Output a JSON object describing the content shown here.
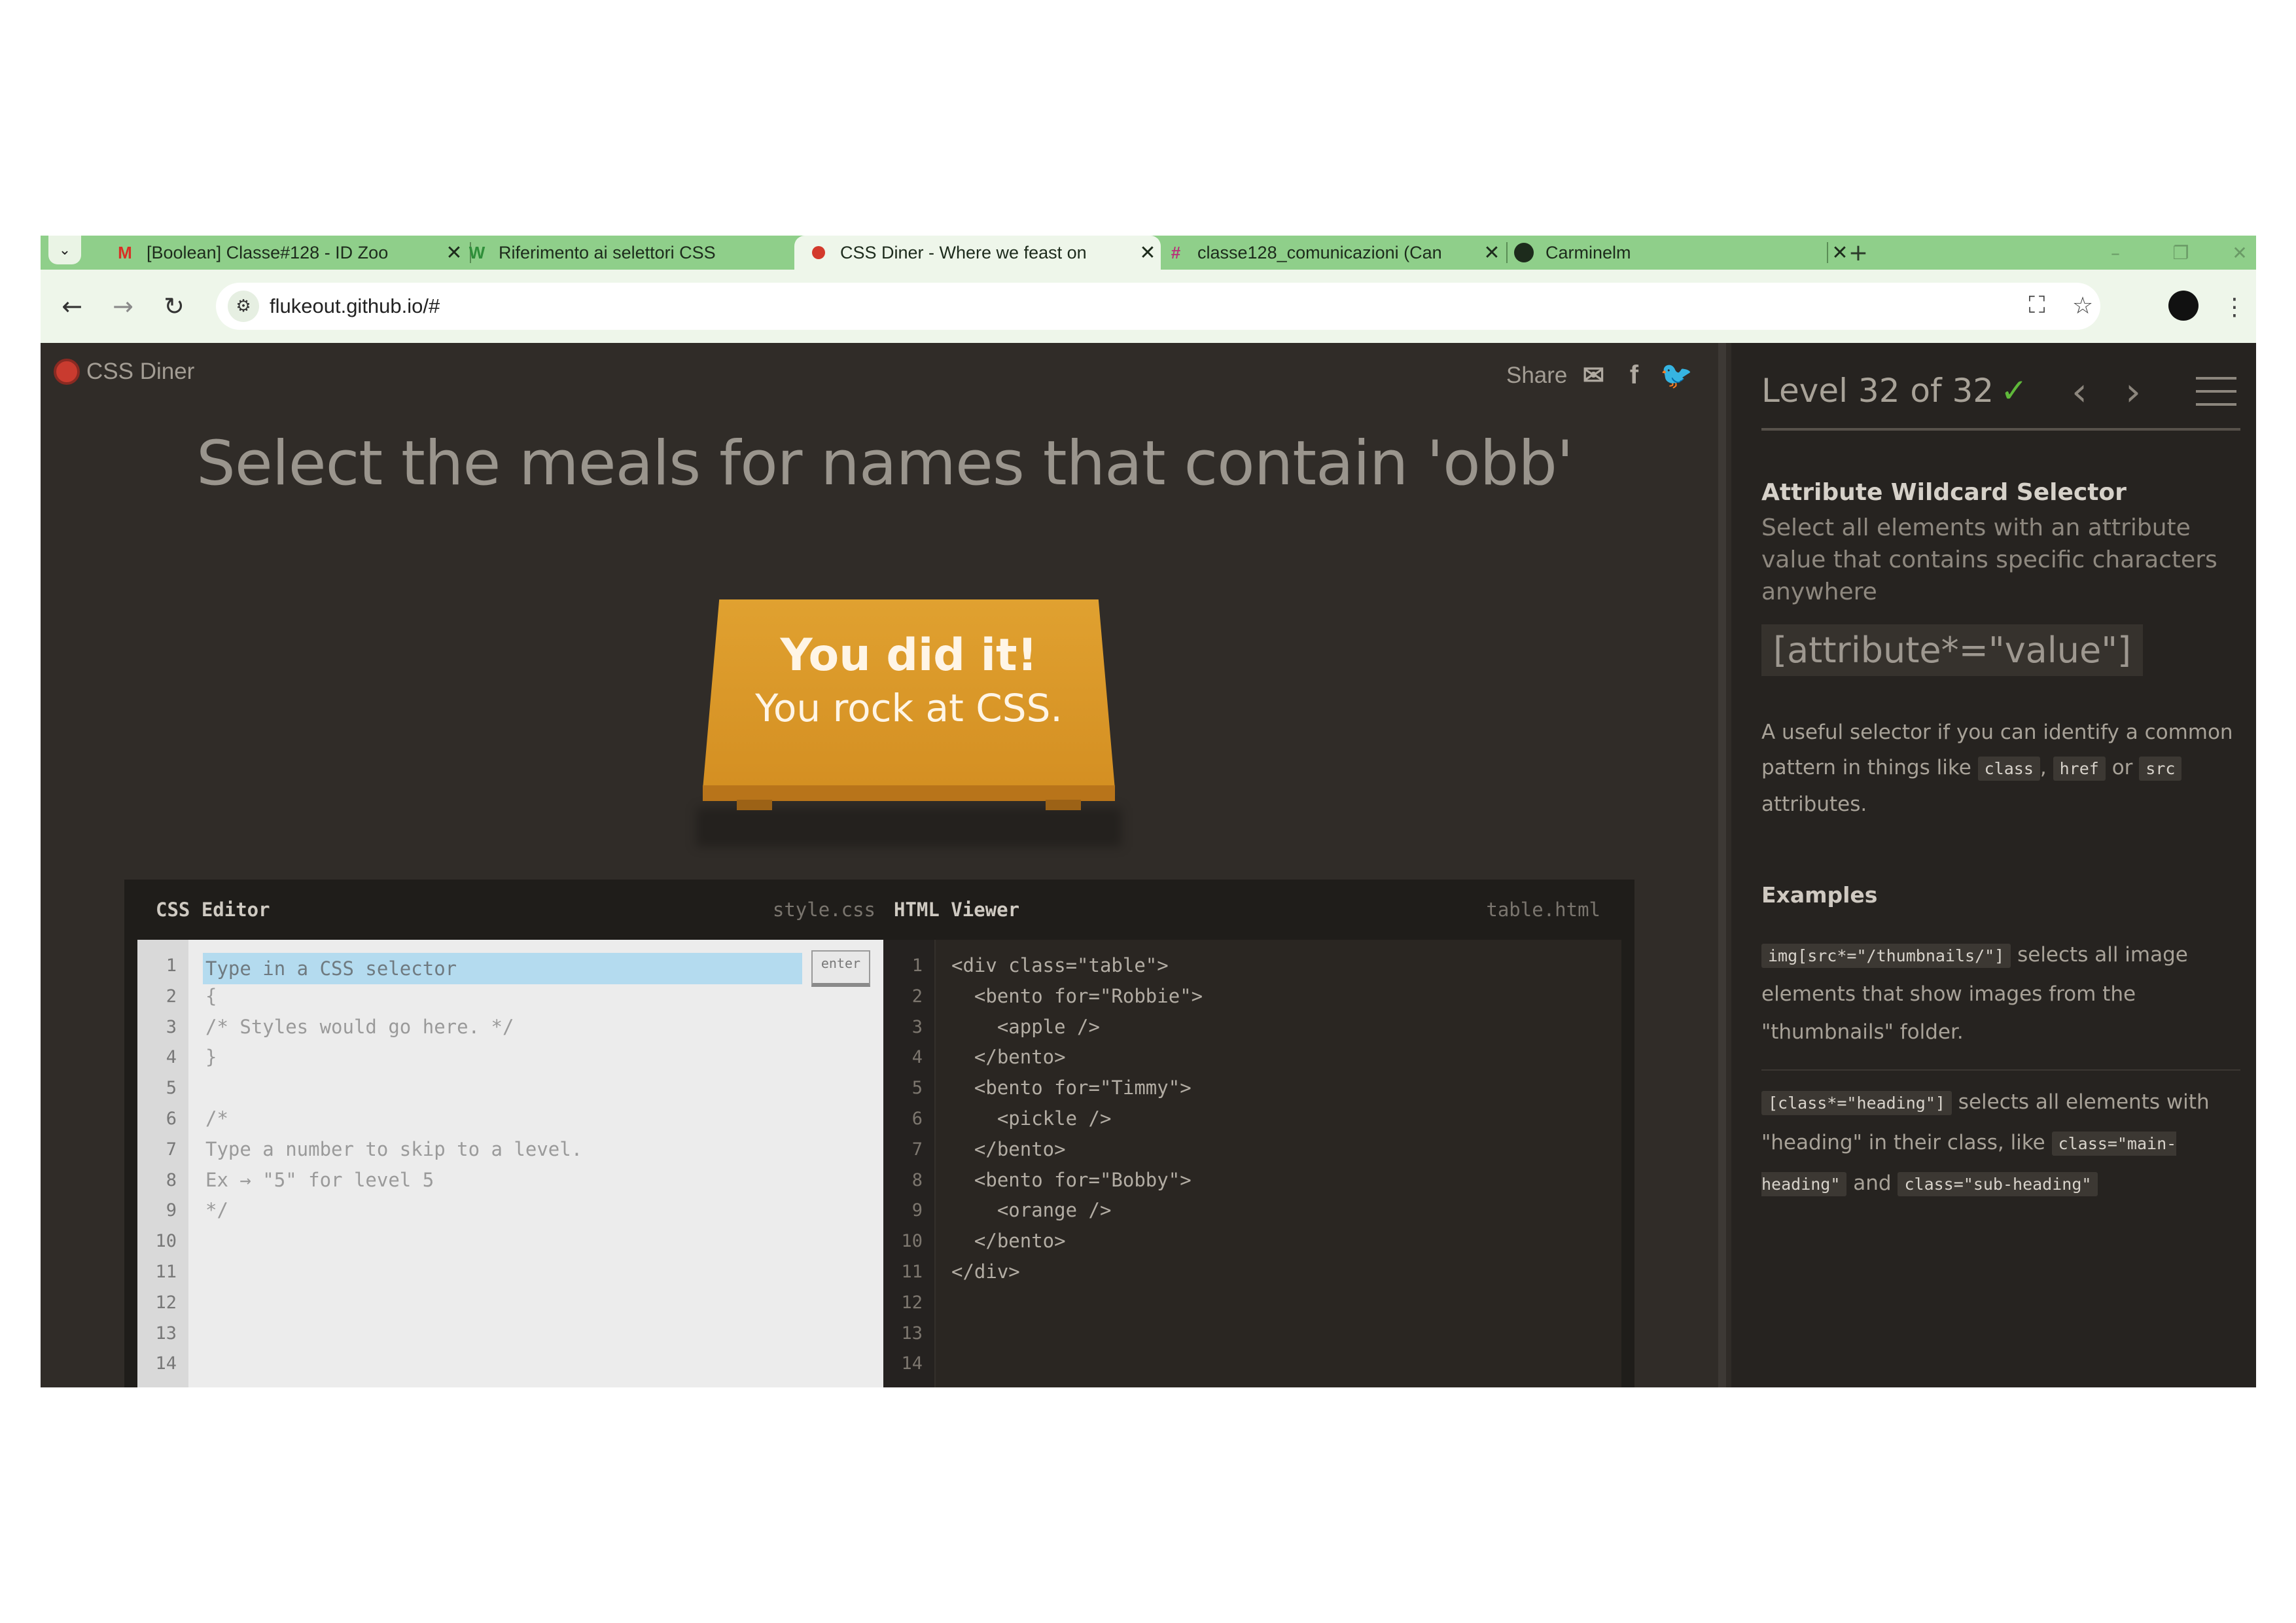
{
  "browser": {
    "tabs": [
      {
        "title": "[Boolean] Classe#128 - ID Zoo",
        "favicon": "gmail-icon",
        "active": false
      },
      {
        "title": "Riferimento ai selettori CSS",
        "favicon": "w3schools-icon",
        "active": false
      },
      {
        "title": "CSS Diner - Where we feast on",
        "favicon": "css-diner-icon",
        "active": true
      },
      {
        "title": "classe128_comunicazioni (Can",
        "favicon": "slack-icon",
        "active": false
      },
      {
        "title": "Carminelm",
        "favicon": "github-icon",
        "active": false
      }
    ],
    "tab_close_glyph": "✕",
    "new_tab_glyph": "+",
    "address": "flukeout.github.io/#",
    "accent_color": "#8fcf8a"
  },
  "page": {
    "logo": "CSS Diner",
    "share_label": "Share",
    "instruction": "Select the meals for names that contain 'obb'",
    "success_line1": "You did it!",
    "success_line2": "You rock at CSS.",
    "css_editor": {
      "title": "CSS Editor",
      "file": "style.css",
      "input_placeholder": "Type in a CSS selector",
      "enter_label": "enter",
      "line_numbers": [
        "1",
        "2",
        "3",
        "4",
        "5",
        "6",
        "7",
        "8",
        "9",
        "10",
        "11",
        "12",
        "13",
        "14"
      ],
      "lines": [
        "",
        "{",
        "/* Styles would go here. */",
        "}",
        "",
        "/*",
        "Type a number to skip to a level.",
        "Ex → \"5\" for level 5",
        "*/"
      ]
    },
    "html_viewer": {
      "title": "HTML Viewer",
      "file": "table.html",
      "line_numbers": [
        "1",
        "2",
        "3",
        "4",
        "5",
        "6",
        "7",
        "8",
        "9",
        "10",
        "11",
        "12",
        "13",
        "14"
      ],
      "lines": [
        "<div class=\"table\">",
        "  <bento for=\"Robbie\">",
        "    <apple />",
        "  </bento>",
        "  <bento for=\"Timmy\">",
        "    <pickle />",
        "  </bento>",
        "  <bento for=\"Bobby\">",
        "    <orange />",
        "  </bento>",
        "</div>"
      ]
    }
  },
  "sidebar": {
    "level": "Level 32 of 32",
    "selector_name": "Attribute Wildcard Selector",
    "selector_desc": "Select all elements with an attribute value that contains specific characters anywhere",
    "syntax": "[attribute*=\"value\"]",
    "hint_prefix": "A useful selector if you can identify a common pattern in things like",
    "hint_tag1": "class",
    "hint_comma": ",",
    "hint_tag2": "href",
    "hint_or": "or",
    "hint_tag3": "src",
    "hint_suffix": "attributes.",
    "examples_title": "Examples",
    "ex1_code": "img[src*=\"/thumbnails/\"]",
    "ex1_text": "selects all image elements that show images from the \"thumbnails\" folder.",
    "ex2_code": "[class*=\"heading\"]",
    "ex2_text": "selects all elements with \"heading\" in their class, like",
    "ex2_code2": "class=\"main-heading\"",
    "ex2_and": "and",
    "ex2_code3": "class=\"sub-heading\""
  }
}
